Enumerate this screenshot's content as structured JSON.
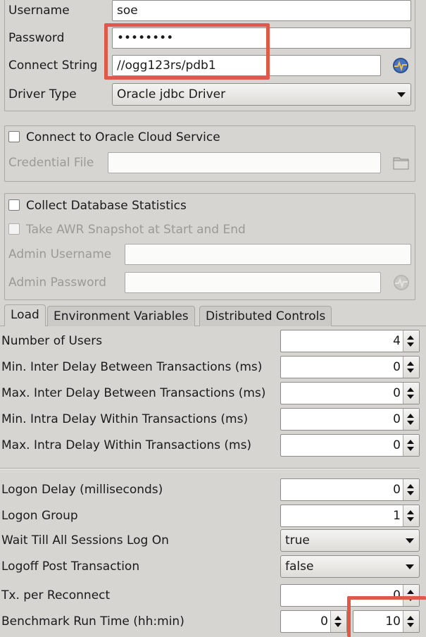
{
  "connection": {
    "username_label": "Username",
    "username_value": "soe",
    "password_label": "Password",
    "password_value": "••••••••",
    "connect_string_label": "Connect String",
    "connect_string_value": "//ogg123rs/pdb1",
    "driver_type_label": "Driver Type",
    "driver_type_value": "Oracle jdbc Driver"
  },
  "cloud": {
    "connect_label": "Connect to Oracle Cloud Service",
    "credential_file_label": "Credential File",
    "credential_file_value": ""
  },
  "stats": {
    "collect_label": "Collect Database Statistics",
    "awr_label": "Take AWR Snapshot at Start and End",
    "admin_username_label": "Admin Username",
    "admin_username_value": "",
    "admin_password_label": "Admin Password",
    "admin_password_value": ""
  },
  "tabs": [
    {
      "label": "Load"
    },
    {
      "label": "Environment Variables"
    },
    {
      "label": "Distributed Controls"
    }
  ],
  "load": {
    "rows": [
      {
        "label": "Number of Users",
        "value": "4"
      },
      {
        "label": "Min. Inter Delay Between Transactions (ms)",
        "value": "0"
      },
      {
        "label": "Max. Inter Delay Between Transactions (ms)",
        "value": "0"
      },
      {
        "label": "Min. Intra Delay Within Transactions (ms)",
        "value": "0"
      },
      {
        "label": "Max. Intra Delay Within Transactions (ms)",
        "value": "0"
      }
    ],
    "logon_delay_label": "Logon Delay (milliseconds)",
    "logon_delay_value": "0",
    "logon_group_label": "Logon Group",
    "logon_group_value": "1",
    "wait_label": "Wait Till All Sessions Log On",
    "wait_value": "true",
    "logoff_label": "Logoff Post Transaction",
    "logoff_value": "false",
    "tx_reconnect_label": "Tx. per Reconnect",
    "tx_reconnect_value": "0",
    "run_time_label": "Benchmark Run Time (hh:min)",
    "run_time_hours": "0",
    "run_time_minutes": "10"
  },
  "colors": {
    "highlight": "#e0584a",
    "background": "#d6d5d1"
  }
}
